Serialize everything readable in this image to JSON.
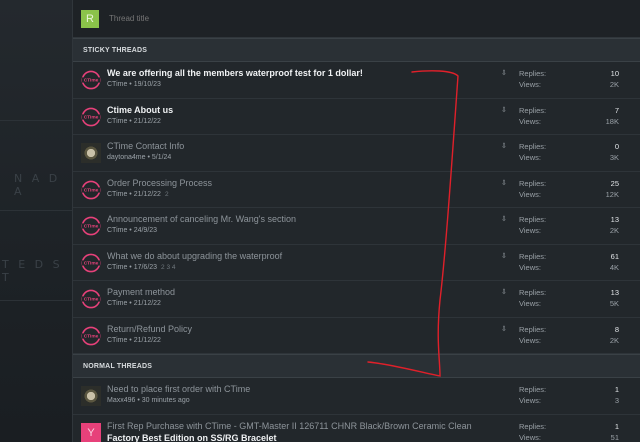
{
  "background": {
    "map_labels": [
      "N A D A",
      "T E D  S T"
    ]
  },
  "composer": {
    "avatar_letter": "R",
    "title_placeholder": "Thread title"
  },
  "sticky": {
    "heading": "STICKY THREADS",
    "rows": [
      {
        "title": "We are offering all the members waterproof test for 1 dollar!",
        "meta": "CTime • 19/10/23",
        "pages": "",
        "replies": "10",
        "views": "2K",
        "bold": true,
        "avatar": "ctime"
      },
      {
        "title": "Ctime About us",
        "meta": "CTime • 21/12/22",
        "pages": "",
        "replies": "7",
        "views": "18K",
        "bold": true,
        "avatar": "ctime"
      },
      {
        "title": "CTime Contact Info",
        "meta": "daytona4me • 5/1/24",
        "pages": "",
        "replies": "0",
        "views": "3K",
        "bold": false,
        "avatar": "photo"
      },
      {
        "title": "Order Processing Process",
        "meta": "CTime • 21/12/22",
        "pages": "2",
        "replies": "25",
        "views": "12K",
        "bold": false,
        "avatar": "ctime"
      },
      {
        "title": "Announcement of canceling Mr. Wang's section",
        "meta": "CTime • 24/9/23",
        "pages": "",
        "replies": "13",
        "views": "2K",
        "bold": false,
        "avatar": "ctime"
      },
      {
        "title": "What we do about upgrading the waterproof",
        "meta": "CTime • 17/6/23",
        "pages": "2 3 4",
        "replies": "61",
        "views": "4K",
        "bold": false,
        "avatar": "ctime"
      },
      {
        "title": "Payment method",
        "meta": "CTime • 21/12/22",
        "pages": "",
        "replies": "13",
        "views": "5K",
        "bold": false,
        "avatar": "ctime"
      },
      {
        "title": "Return/Refund Policy",
        "meta": "CTime • 21/12/22",
        "pages": "",
        "replies": "8",
        "views": "2K",
        "bold": false,
        "avatar": "ctime"
      }
    ]
  },
  "normal": {
    "heading": "NORMAL THREADS",
    "rows": [
      {
        "title": "Need to place first order with CTime",
        "meta": "Maxx496 • 30 minutes ago",
        "replies": "1",
        "views": "3",
        "avatar": "photo"
      },
      {
        "title": "First Rep Purchase with CTime - GMT-Master II 126711 CHNR Black/Brown Ceramic Clean",
        "title2": "Factory Best Edition on SS/RG Bracelet",
        "replies": "1",
        "views": "51",
        "avatar_letter": "Y"
      }
    ]
  },
  "labels": {
    "replies": "Replies:",
    "views": "Views:",
    "pin_glyph": "⇩",
    "logo_text": "CTime"
  },
  "colors": {
    "accent_pink": "#e7417a",
    "composer_avatar": "#8bc34a",
    "annotation_red": "#e0202a"
  }
}
